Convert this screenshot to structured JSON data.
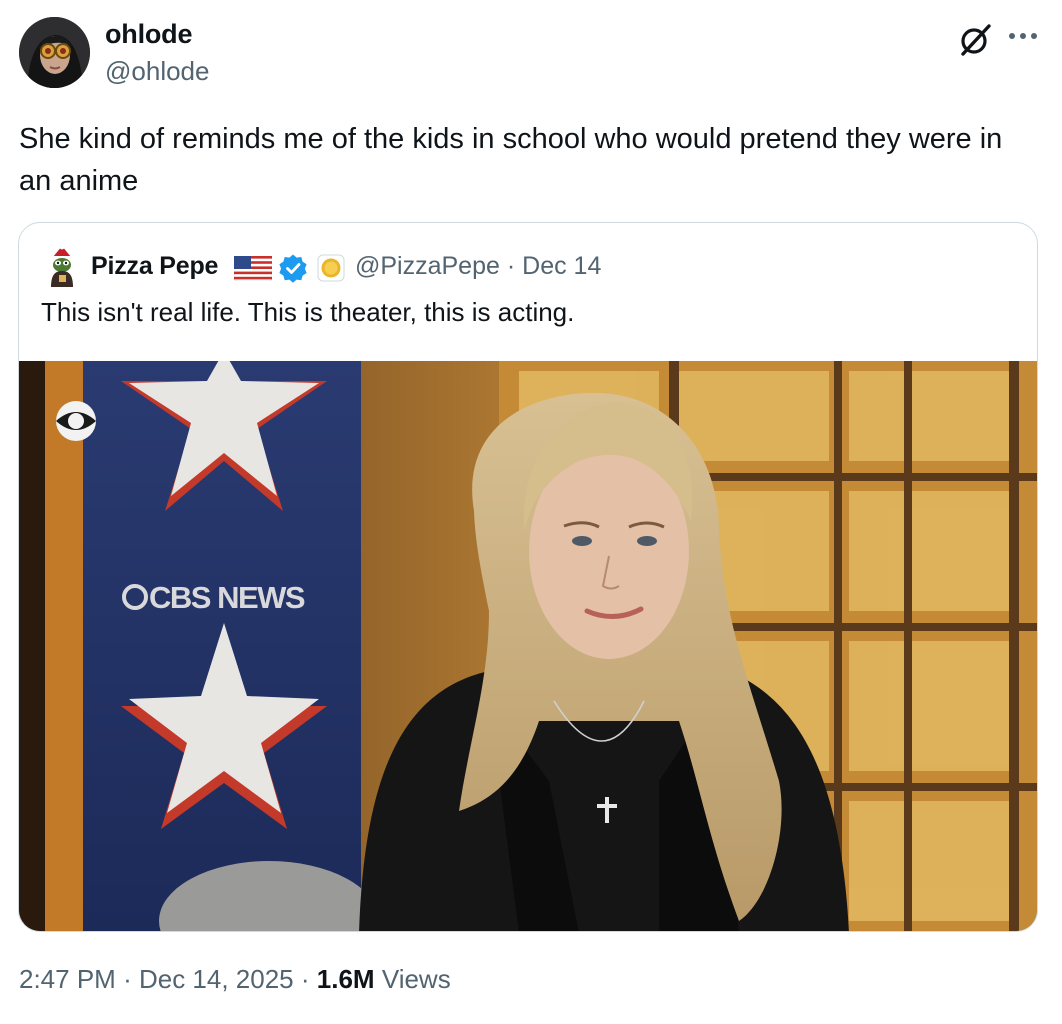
{
  "author": {
    "name": "ohlode",
    "handle": "@ohlode"
  },
  "tweet": {
    "text": "She kind of reminds me of the kids in school who would pretend they were in an anime",
    "time": "2:47 PM",
    "date": "Dec 14, 2025",
    "views_count": "1.6M",
    "views_label": "Views",
    "separator": "·"
  },
  "quoted": {
    "name": "Pizza Pepe",
    "handle": "@PizzaPepe",
    "date": "Dec 14",
    "separator": "·",
    "text": "This isn't real life. This is theater, this is acting.",
    "media": {
      "watermark": "CBS NEWS"
    }
  },
  "icons": {
    "grok": "grok-icon",
    "more": "more-icon",
    "flag": "us-flag-icon",
    "verified": "verified-badge-icon",
    "coin": "gold-coin-icon"
  },
  "colors": {
    "text_primary": "#0f1419",
    "text_secondary": "#536471",
    "verified_blue": "#1d9bf0",
    "border": "#cfd9de"
  }
}
